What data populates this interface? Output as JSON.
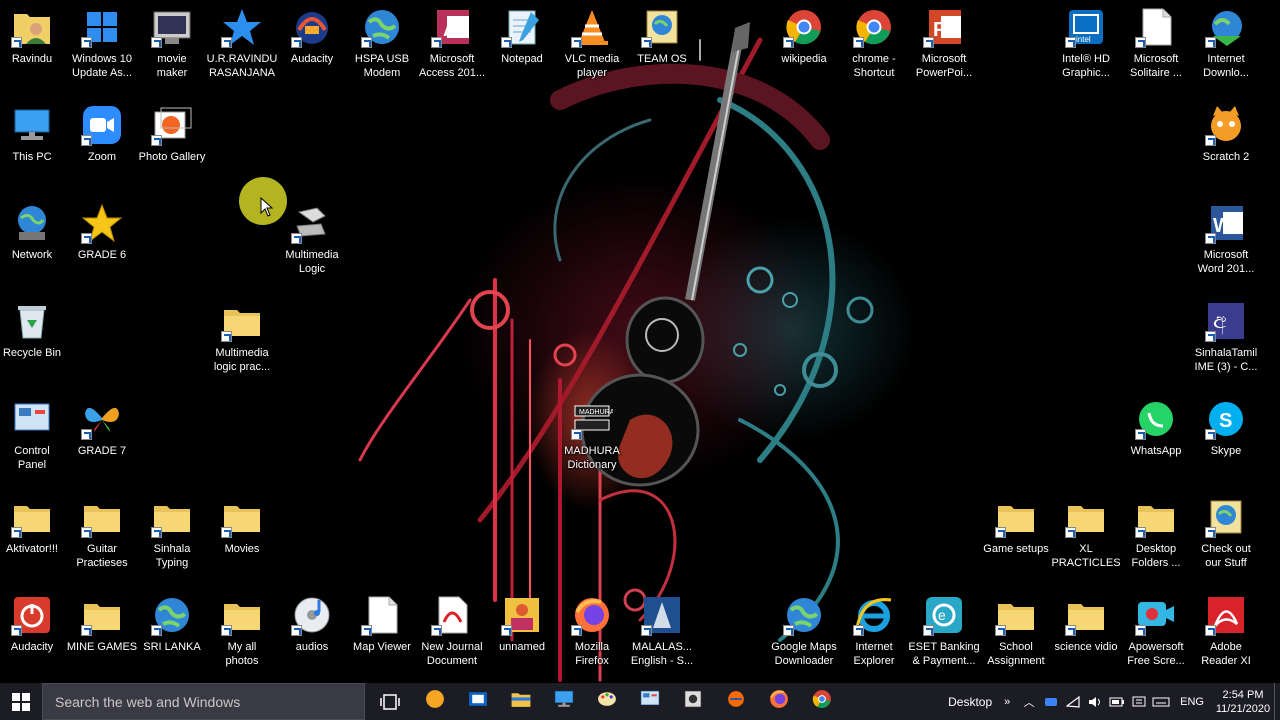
{
  "desktop": {
    "icons": [
      {
        "label": "Ravindu",
        "icon": "user-folder-icon"
      },
      {
        "label": "Windows 10\nUpdate As...",
        "icon": "windows-logo-icon"
      },
      {
        "label": "movie\nmaker",
        "icon": "movie-maker-icon"
      },
      {
        "label": "U.R.RAVINDU\nRASANJANA",
        "icon": "blue-star-icon"
      },
      {
        "label": "Audacity",
        "icon": "audacity-icon"
      },
      {
        "label": "HSPA USB\nModem",
        "icon": "globe-icon"
      },
      {
        "label": "Microsoft\nAccess 201...",
        "icon": "access-icon"
      },
      {
        "label": "Notepad",
        "icon": "notepad-icon"
      },
      {
        "label": "VLC media\nplayer",
        "icon": "vlc-cone-icon"
      },
      {
        "label": "TEAM OS",
        "icon": "globe-book-icon"
      },
      {
        "label": "wikipedia",
        "icon": "chrome-icon"
      },
      {
        "label": "chrome -\nShortcut",
        "icon": "chrome-icon"
      },
      {
        "label": "Microsoft\nPowerPoi...",
        "icon": "powerpoint-icon"
      },
      {
        "label": "Intel® HD\nGraphic...",
        "icon": "intel-graphics-icon"
      },
      {
        "label": "Microsoft\nSolitaire ...",
        "icon": "document-icon"
      },
      {
        "label": "Internet\nDownlo...",
        "icon": "idm-globe-icon"
      },
      {
        "label": "This PC",
        "icon": "computer-icon"
      },
      {
        "label": "Zoom",
        "icon": "zoom-camera-icon"
      },
      {
        "label": "Photo Gallery",
        "icon": "photo-gallery-icon"
      },
      {
        "label": "Scratch 2",
        "icon": "scratch-cat-icon"
      },
      {
        "label": "Network",
        "icon": "network-globe-icon"
      },
      {
        "label": "GRADE 6",
        "icon": "gold-star-icon"
      },
      {
        "label": "Multimedia\nLogic",
        "icon": "multimedia-logic-icon"
      },
      {
        "label": "Microsoft\nWord 201...",
        "icon": "word-icon"
      },
      {
        "label": "Recycle Bin",
        "icon": "recycle-bin-icon"
      },
      {
        "label": "Multimedia\nlogic prac...",
        "icon": "folder-icon"
      },
      {
        "label": "SinhalaTamil\nIME (3) - C...",
        "icon": "sinhala-tamil-ime-icon"
      },
      {
        "label": "Control\nPanel",
        "icon": "control-panel-icon"
      },
      {
        "label": "GRADE 7",
        "icon": "butterfly-icon"
      },
      {
        "label": "MADHURA\nDictionary",
        "icon": "dictionary-icon"
      },
      {
        "label": "WhatsApp",
        "icon": "whatsapp-icon"
      },
      {
        "label": "Skype",
        "icon": "skype-icon"
      },
      {
        "label": "Aktivator!!!",
        "icon": "folder-icon"
      },
      {
        "label": "Guitar\nPractieses",
        "icon": "folder-icon"
      },
      {
        "label": "Sinhala\nTyping",
        "icon": "folder-icon"
      },
      {
        "label": "Movies",
        "icon": "folder-icon"
      },
      {
        "label": "Game setups",
        "icon": "folder-icon"
      },
      {
        "label": "XL\nPRACTICLES",
        "icon": "folder-icon"
      },
      {
        "label": "Desktop\nFolders ...",
        "icon": "folder-icon"
      },
      {
        "label": "Check out\nour Stuff",
        "icon": "globe-book-icon"
      },
      {
        "label": "Audacity",
        "icon": "power-icon"
      },
      {
        "label": "MINE GAMES",
        "icon": "folder-icon"
      },
      {
        "label": "SRI LANKA",
        "icon": "globe-icon"
      },
      {
        "label": "My all\nphotos",
        "icon": "folder-icon"
      },
      {
        "label": "audios",
        "icon": "cd-music-icon"
      },
      {
        "label": "Map Viewer",
        "icon": "document-icon"
      },
      {
        "label": "New Journal\nDocument",
        "icon": "pdf-icon"
      },
      {
        "label": "unnamed",
        "icon": "image-icon"
      },
      {
        "label": "Mozilla\nFirefox",
        "icon": "firefox-icon"
      },
      {
        "label": "MALALAS...\nEnglish - S...",
        "icon": "malalasekara-icon"
      },
      {
        "label": "Google Maps\nDownloader",
        "icon": "globe-icon"
      },
      {
        "label": "Internet\nExplorer",
        "icon": "ie-icon"
      },
      {
        "label": "ESET Banking\n& Payment...",
        "icon": "eset-icon"
      },
      {
        "label": "School\nAssignment",
        "icon": "folder-icon"
      },
      {
        "label": "science vidio",
        "icon": "folder-icon"
      },
      {
        "label": "Apowersoft\nFree Scre...",
        "icon": "screen-recorder-icon"
      },
      {
        "label": "Adobe\nReader XI",
        "icon": "adobe-reader-icon"
      }
    ]
  },
  "taskbar": {
    "search_placeholder": "Search the web and Windows",
    "desktop_label": "Desktop",
    "language": "ENG",
    "time": "2:54 PM",
    "date": "11/21/2020",
    "apps": [
      "orange-circle-app-icon",
      "outlook-icon",
      "file-explorer-icon",
      "computer-icon",
      "paint-icon",
      "control-panel-icon",
      "media-app-icon",
      "orange-app-icon",
      "firefox-icon",
      "chrome-icon"
    ]
  }
}
